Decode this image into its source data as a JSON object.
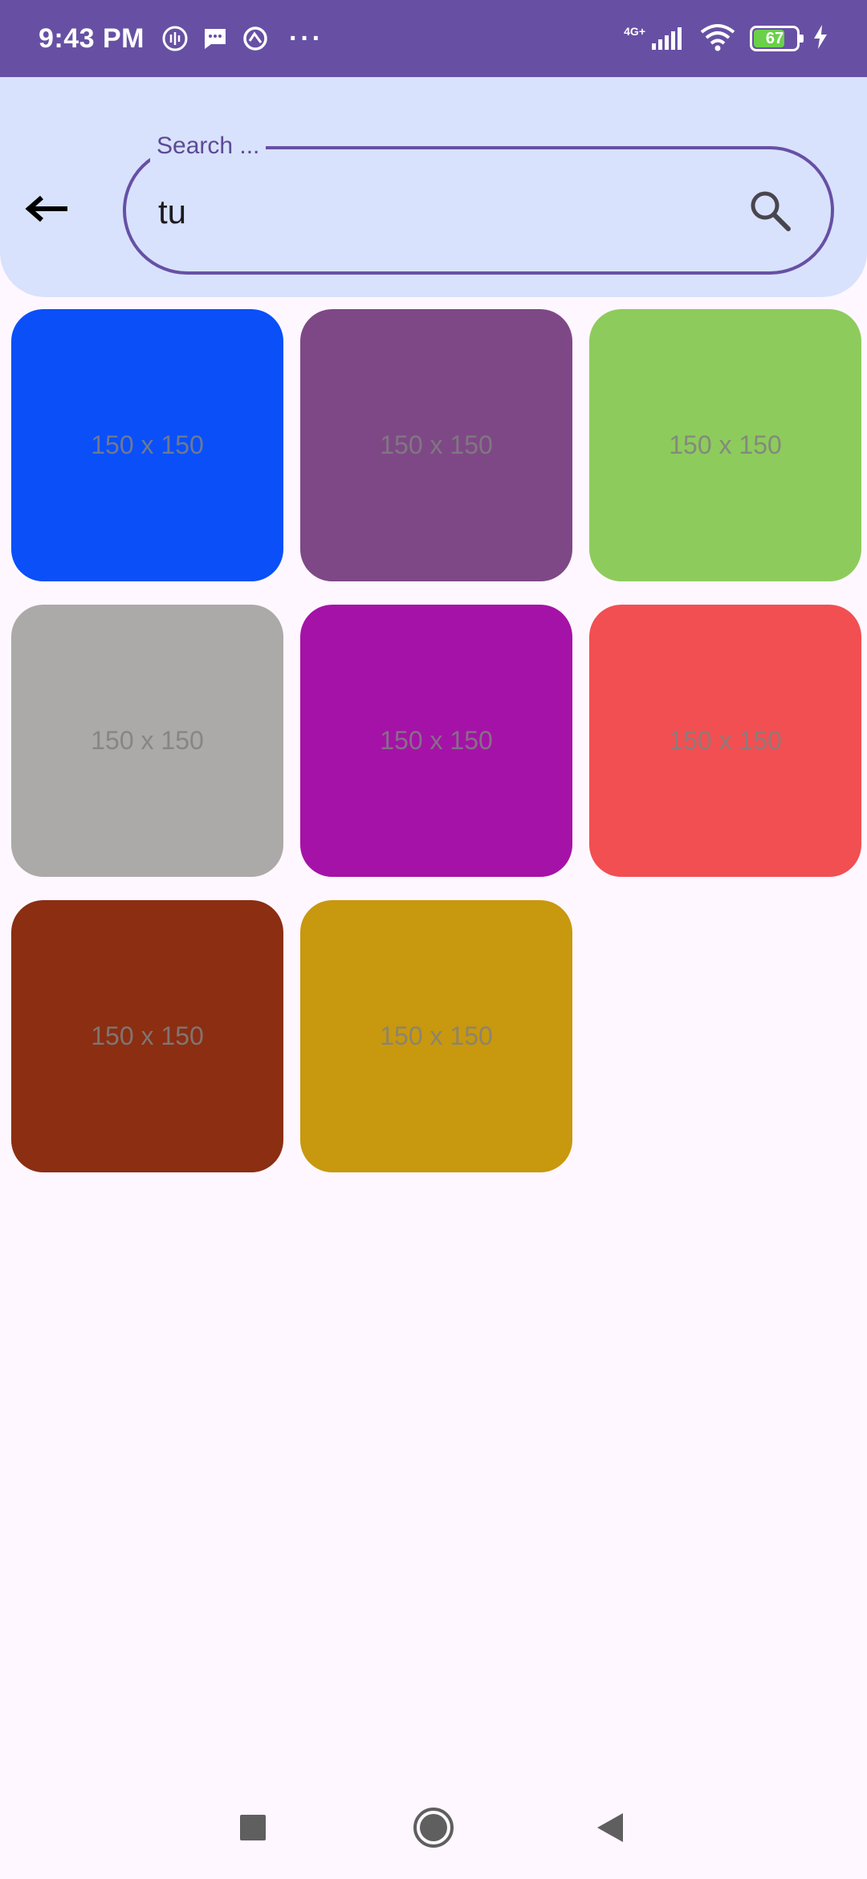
{
  "status_bar": {
    "time": "9:43 PM",
    "more": "···",
    "network": "4G+",
    "battery": "67",
    "icons": [
      "call-recording-icon",
      "message-icon",
      "vpn-icon",
      "signal-icon",
      "wifi-icon",
      "battery-icon",
      "charging-icon"
    ]
  },
  "search": {
    "label": "Search ...",
    "value": "tu"
  },
  "tiles": [
    {
      "label": "150 x 150",
      "color": "#0a4ff8"
    },
    {
      "label": "150 x 150",
      "color": "#7e4886"
    },
    {
      "label": "150 x 150",
      "color": "#8ecb5d"
    },
    {
      "label": "150 x 150",
      "color": "#abaaa8"
    },
    {
      "label": "150 x 150",
      "color": "#a512a7"
    },
    {
      "label": "150 x 150",
      "color": "#f24f52"
    },
    {
      "label": "150 x 150",
      "color": "#8b2e12"
    },
    {
      "label": "150 x 150",
      "color": "#c8980e"
    }
  ],
  "colors": {
    "status_bar": "#6750a4",
    "header": "#d8e2fc",
    "background": "#fef7ff",
    "accent": "#6750a4"
  }
}
